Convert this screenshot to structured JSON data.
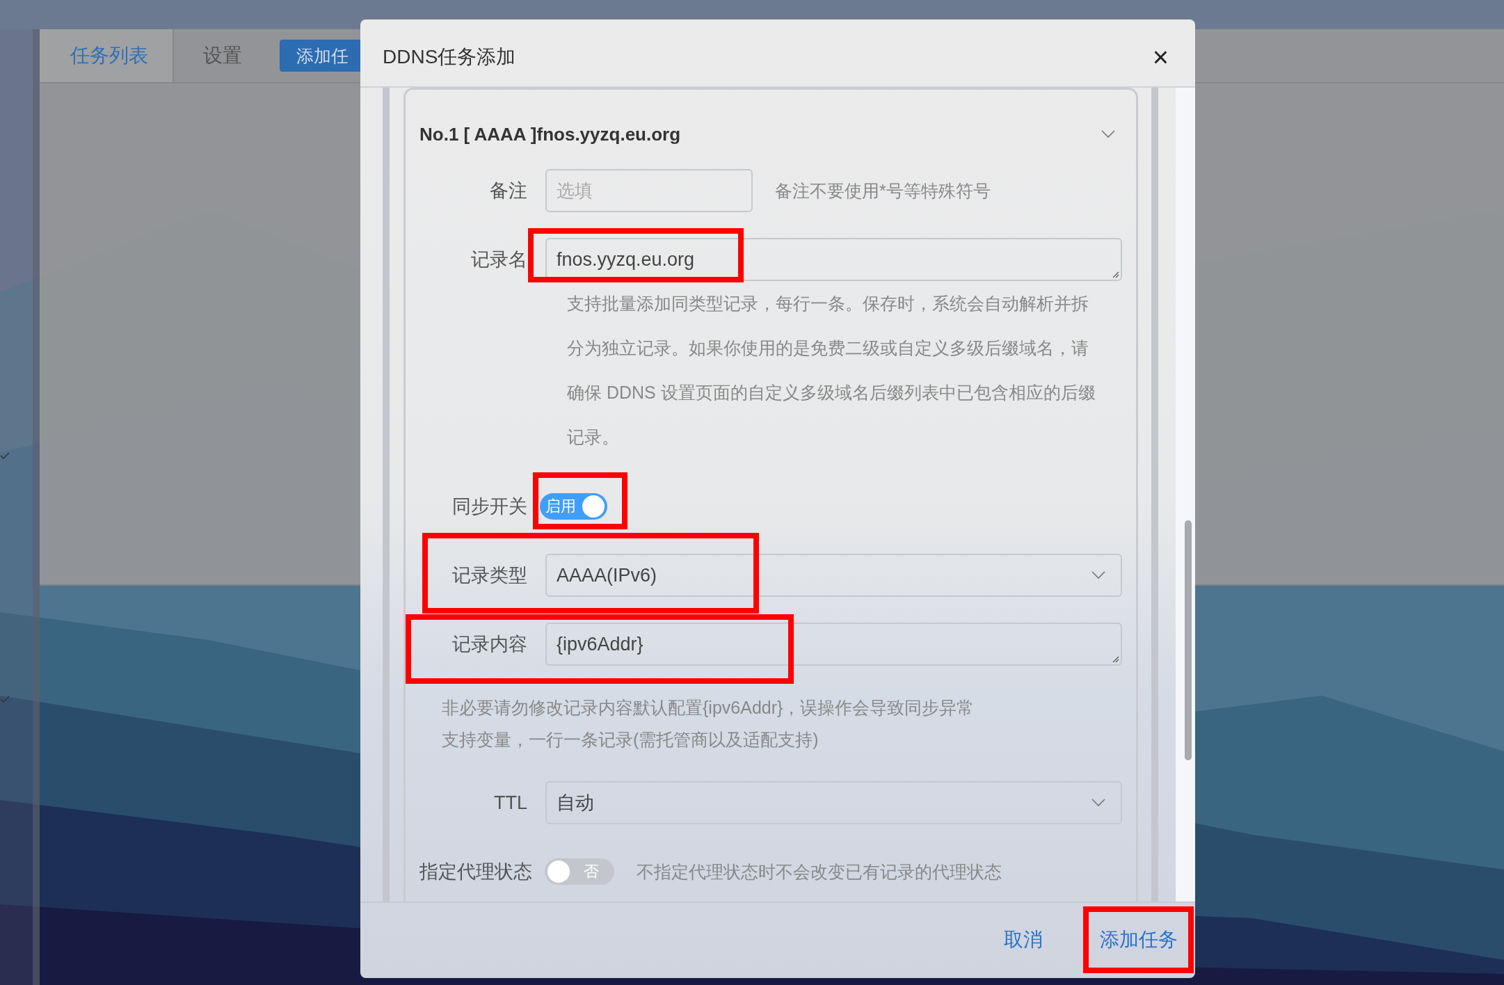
{
  "app": {
    "tabs": [
      {
        "label": "任务列表",
        "selected": true
      },
      {
        "label": "设置",
        "selected": false
      }
    ],
    "add_button": "添加任"
  },
  "dialog": {
    "title": "DDNS任务添加",
    "close": "×",
    "record": {
      "title": "No.1 [ AAAA ]fnos.yyzq.eu.org",
      "expanded": true,
      "fields": [
        {
          "kind": "input",
          "label": "备注",
          "placeholder": "选填",
          "hint": "备注不要使用*号等特殊符号"
        },
        {
          "kind": "textarea",
          "label": "记录名",
          "value": "fnos.yyzq.eu.org",
          "highlighted": true,
          "highlight_includes_label": false,
          "help_lines": [
            "支持批量添加同类型记录，每行一条。保存时，系统会自动解析并拆",
            "分为独立记录。如果你使用的是免费二级或自定义多级后缀域名，请",
            "确保 DDNS 设置页面的自定义多级域名后缀列表中已包含相应的后缀",
            "记录。"
          ]
        },
        {
          "kind": "switch",
          "label": "同步开关",
          "on": true,
          "text": "启用",
          "highlighted": true,
          "highlight_includes_label": false
        },
        {
          "kind": "select",
          "label": "记录类型",
          "value": "AAAA(IPv6)",
          "highlighted": true,
          "highlight_includes_label": true
        },
        {
          "kind": "textarea",
          "label": "记录内容",
          "value": "{ipv6Addr}",
          "highlighted": true,
          "highlight_includes_label": true
        },
        {
          "kind": "note",
          "lines": [
            "非必要请勿修改记录内容默认配置{ipv6Addr}，误操作会导致同步异常",
            "支持变量，一行一条记录(需托管商以及适配支持)"
          ]
        },
        {
          "kind": "select",
          "label": "TTL",
          "value": "自动"
        },
        {
          "kind": "switch",
          "label": "指定代理状态",
          "on": false,
          "text": "否",
          "hint": "不指定代理状态时不会改变已有记录的代理状态"
        }
      ]
    }
  },
  "buttons": [
    {
      "label": "取消",
      "highlight": false
    },
    {
      "label": "添加任务",
      "highlight": true
    }
  ]
}
